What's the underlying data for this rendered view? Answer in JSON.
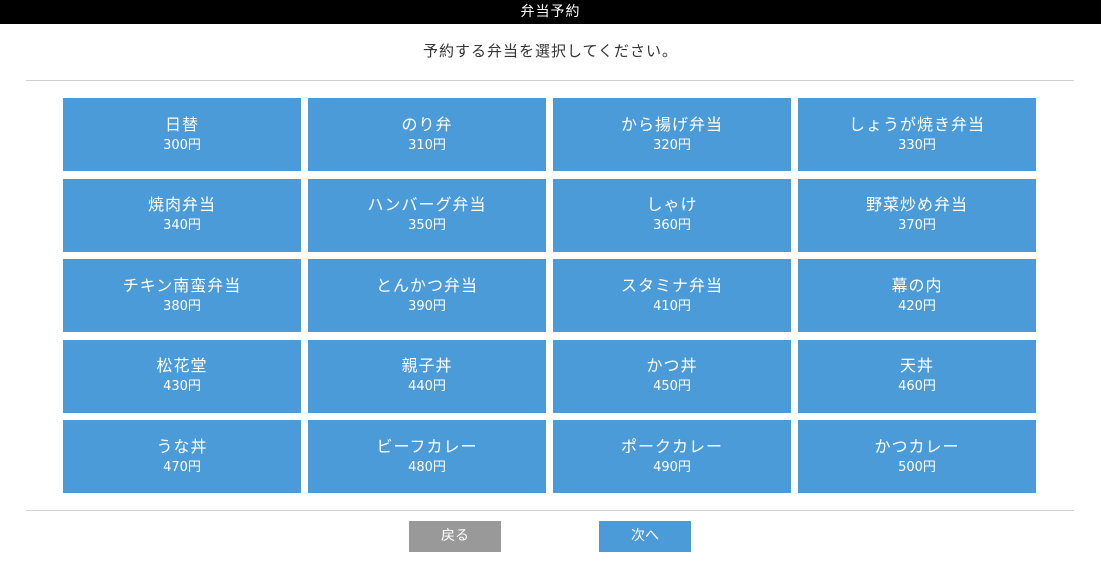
{
  "header": {
    "title": "弁当予約"
  },
  "instruction": "予約する弁当を選択してください。",
  "menu": [
    {
      "name": "日替",
      "price": "300円"
    },
    {
      "name": "のり弁",
      "price": "310円"
    },
    {
      "name": "から揚げ弁当",
      "price": "320円"
    },
    {
      "name": "しょうが焼き弁当",
      "price": "330円"
    },
    {
      "name": "焼肉弁当",
      "price": "340円"
    },
    {
      "name": "ハンバーグ弁当",
      "price": "350円"
    },
    {
      "name": "しゃけ",
      "price": "360円"
    },
    {
      "name": "野菜炒め弁当",
      "price": "370円"
    },
    {
      "name": "チキン南蛮弁当",
      "price": "380円"
    },
    {
      "name": "とんかつ弁当",
      "price": "390円"
    },
    {
      "name": "スタミナ弁当",
      "price": "410円"
    },
    {
      "name": "幕の内",
      "price": "420円"
    },
    {
      "name": "松花堂",
      "price": "430円"
    },
    {
      "name": "親子丼",
      "price": "440円"
    },
    {
      "name": "かつ丼",
      "price": "450円"
    },
    {
      "name": "天丼",
      "price": "460円"
    },
    {
      "name": "うな丼",
      "price": "470円"
    },
    {
      "name": "ビーフカレー",
      "price": "480円"
    },
    {
      "name": "ポークカレー",
      "price": "490円"
    },
    {
      "name": "かつカレー",
      "price": "500円"
    }
  ],
  "buttons": {
    "back": "戻る",
    "next": "次へ"
  },
  "colors": {
    "tile": "#4c9bd9",
    "back_button": "#999999",
    "titlebar": "#000000"
  }
}
